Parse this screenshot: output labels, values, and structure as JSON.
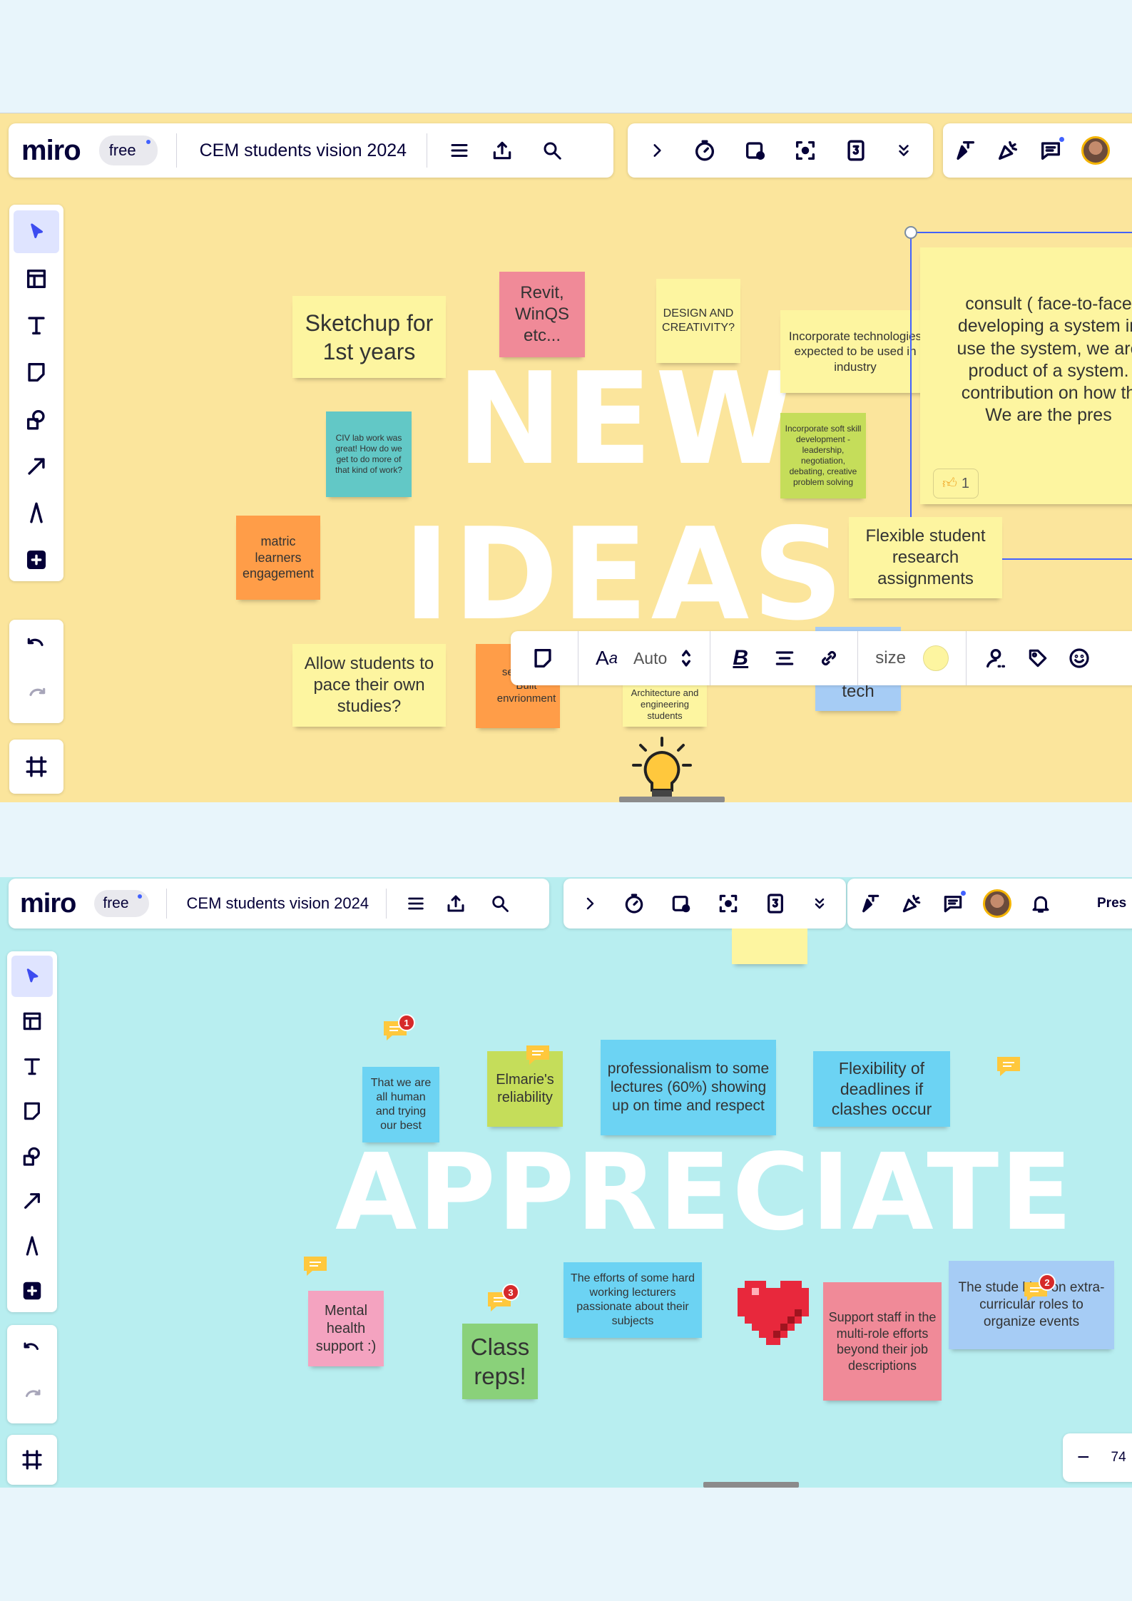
{
  "app": {
    "logo": "miro",
    "plan_badge": "free",
    "board_title": "CEM students vision 2024",
    "share_label": "Pres",
    "zoom_minus": "−",
    "zoom_value": "74"
  },
  "format_toolbar": {
    "font_size": "Auto",
    "size_label": "size",
    "color_swatch": "#fdf5a0"
  },
  "reactions": {
    "thumbs_count": "1"
  },
  "panel1": {
    "background": "#fbe59c",
    "headline_1": "NEW",
    "headline_2": "IDEAS",
    "stickies": [
      {
        "text": "Sketchup for 1st years",
        "color": "#fdf5a0"
      },
      {
        "text": "Revit, WinQS etc...",
        "color": "#f08a98"
      },
      {
        "text": "DESIGN AND CREATIVITY?",
        "color": "#fdf5a0"
      },
      {
        "text": "Incorporate technologies expected to be used in industry",
        "color": "#fdf5a0"
      },
      {
        "text": "consult ( face-to-face developing a system in use the system, we are product of a system. contribution on how th We are the pres",
        "color": "#fdf5a0"
      },
      {
        "text": "CIV lab work was great! How do we get to do more of that kind of work?",
        "color": "#62c8c6"
      },
      {
        "text": "Incorporate soft skill development - leadership, negotiation, debating, creative problem solving",
        "color": "#c5dd5a"
      },
      {
        "text": "matric learners engagement",
        "color": "#ff9d48"
      },
      {
        "text": "Flexible student research assignments",
        "color": "#fdf5a0"
      },
      {
        "text": "Allow students to pace their own studies?",
        "color": "#fdf5a0"
      },
      {
        "text": "se acti the Built envrionment",
        "color": "#ff9d48"
      },
      {
        "text": "Architecture and engineering students",
        "color": "#fdf5a0"
      },
      {
        "text": "tech",
        "color": "#a6ccf5"
      }
    ]
  },
  "panel2": {
    "background": "#b8eef0",
    "headline": "APPRECIATE",
    "stickies": [
      {
        "text": "That we are all human and trying our best",
        "color": "#6cd3f3"
      },
      {
        "text": "Elmarie's reliability",
        "color": "#c5dd5a"
      },
      {
        "text": "professionalism to some lectures (60%) showing up on time and respect",
        "color": "#6cd3f3"
      },
      {
        "text": "Flexibility of deadlines if clashes occur",
        "color": "#6cd3f3"
      },
      {
        "text": "Mental health support :)",
        "color": "#f4a3c0"
      },
      {
        "text": "Class reps!",
        "color": "#8ad17a"
      },
      {
        "text": "The efforts of some hard working lecturers passionate about their subjects",
        "color": "#6cd3f3"
      },
      {
        "text": "Support staff in the multi-role efforts beyond their job descriptions",
        "color": "#f08a98"
      },
      {
        "text": "The stude  king on extra-curricular roles to organize events",
        "color": "#a6ccf5"
      }
    ],
    "comment_badges": [
      "1",
      "3",
      "2"
    ]
  }
}
